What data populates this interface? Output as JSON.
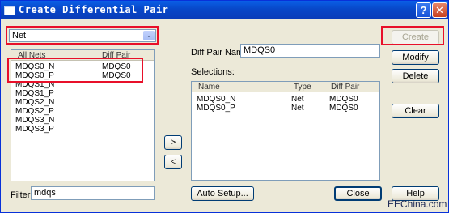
{
  "window": {
    "title": "Create Differential Pair",
    "help_glyph": "?",
    "close_glyph": "✕"
  },
  "type_select": {
    "value": "Net",
    "arrow": "⌄"
  },
  "nets_list": {
    "headers": [
      "All Nets",
      "Diff Pair"
    ],
    "rows": [
      [
        "MDQS0_N",
        "MDQS0"
      ],
      [
        "MDQS0_P",
        "MDQS0"
      ],
      [
        "MDQS1_N",
        ""
      ],
      [
        "MDQS1_P",
        ""
      ],
      [
        "MDQS2_N",
        ""
      ],
      [
        "MDQS2_P",
        ""
      ],
      [
        "MDQS3_N",
        ""
      ],
      [
        "MDQS3_P",
        ""
      ]
    ]
  },
  "filter": {
    "label": "Filter:",
    "value": "mdqs"
  },
  "move_buttons": {
    "right": ">",
    "left": "<"
  },
  "diff_pair_name": {
    "label": "Diff Pair Name:",
    "value": "MDQS0"
  },
  "selections": {
    "label": "Selections:",
    "headers": [
      "Name",
      "Type",
      "Diff Pair"
    ],
    "rows": [
      [
        "MDQS0_N",
        "Net",
        "MDQS0"
      ],
      [
        "MDQS0_P",
        "Net",
        "MDQS0"
      ]
    ]
  },
  "buttons": {
    "create": "Create",
    "modify": "Modify",
    "delete": "Delete",
    "clear": "Clear",
    "auto_setup": "Auto Setup...",
    "close": "Close",
    "help": "Help"
  },
  "watermark": "EEChina.com",
  "colors": {
    "highlight": "#e8102a",
    "titlebar": "#0847c8"
  }
}
